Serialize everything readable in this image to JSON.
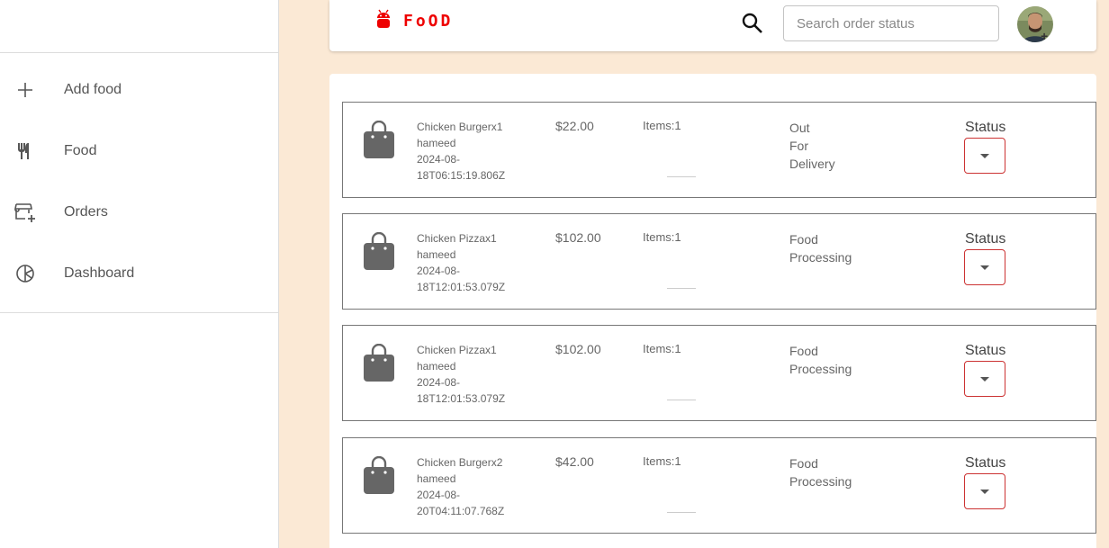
{
  "brand": {
    "name": "FoOD",
    "color": "#e00000"
  },
  "sidebar": {
    "items": [
      {
        "label": "Add food",
        "icon": "plus-icon"
      },
      {
        "label": "Food",
        "icon": "utensils-icon"
      },
      {
        "label": "Orders",
        "icon": "store-add-icon"
      },
      {
        "label": "Dashboard",
        "icon": "pie-chart-icon"
      }
    ]
  },
  "header": {
    "search_placeholder": "Search order status"
  },
  "orders": [
    {
      "name": "Chicken Burgerx1",
      "customer": "hameed",
      "date1": "2024-08-",
      "date2": "18T06:15:19.806Z",
      "price": "$22.00",
      "items": "Items:1",
      "status_lines": [
        "Out",
        "For",
        "Delivery"
      ],
      "status_label": "Status"
    },
    {
      "name": "Chicken Pizzax1",
      "customer": "hameed",
      "date1": "2024-08-",
      "date2": "18T12:01:53.079Z",
      "price": "$102.00",
      "items": "Items:1",
      "status_lines": [
        "Food",
        "Processing"
      ],
      "status_label": "Status"
    },
    {
      "name": "Chicken Pizzax1",
      "customer": "hameed",
      "date1": "2024-08-",
      "date2": "18T12:01:53.079Z",
      "price": "$102.00",
      "items": "Items:1",
      "status_lines": [
        "Food",
        "Processing"
      ],
      "status_label": "Status"
    },
    {
      "name": "Chicken Burgerx2",
      "customer": "hameed",
      "date1": "2024-08-",
      "date2": "20T04:11:07.768Z",
      "price": "$42.00",
      "items": "Items:1",
      "status_lines": [
        "Food",
        "Processing"
      ],
      "status_label": "Status"
    }
  ]
}
